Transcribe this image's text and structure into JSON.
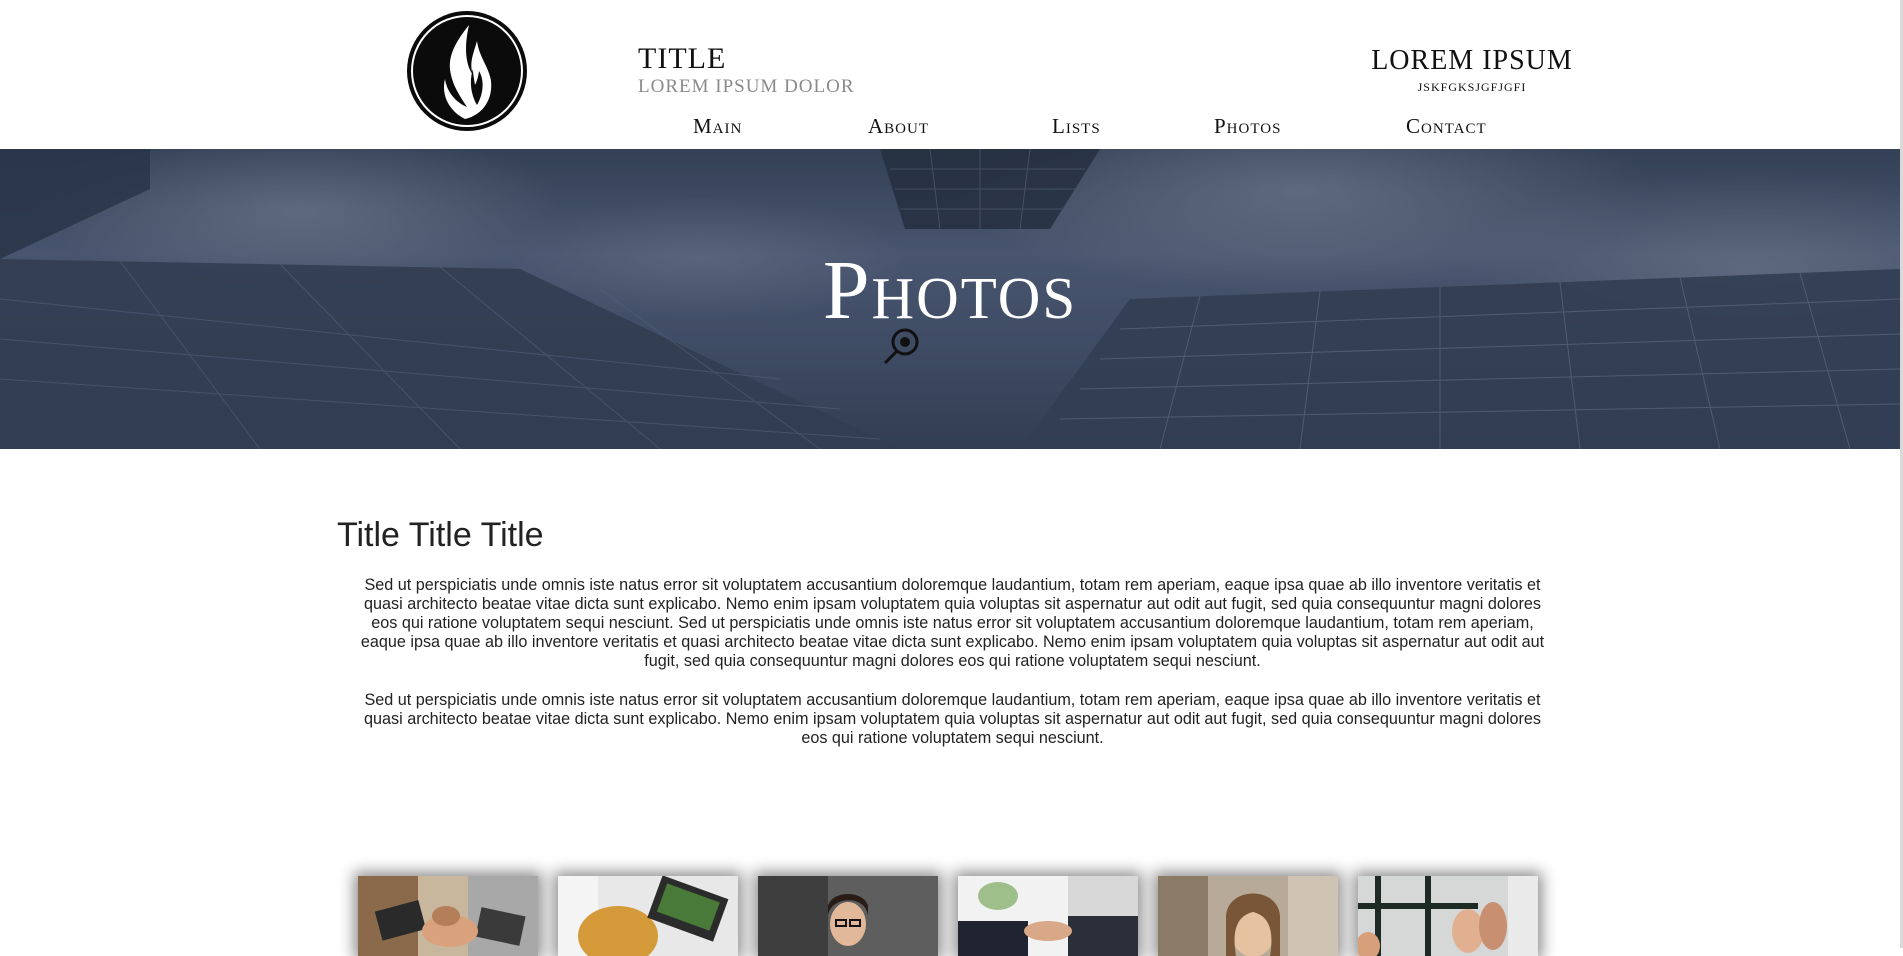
{
  "header": {
    "title": "TITLE",
    "subtitle": "LOREM IPSUM DOLOR",
    "right_title": "LOREM IPSUM",
    "right_subtitle": "JSKFGKSJGFJGFI"
  },
  "nav": {
    "items": [
      {
        "label": "Main"
      },
      {
        "label": "About"
      },
      {
        "label": "Lists"
      },
      {
        "label": "Photos"
      },
      {
        "label": "Contact"
      }
    ]
  },
  "hero": {
    "title": "Photos"
  },
  "content": {
    "title": "Title Title Title",
    "paragraphs": [
      "Sed ut perspiciatis unde omnis iste natus error sit voluptatem accusantium doloremque laudantium, totam rem aperiam, eaque ipsa quae ab illo inventore veritatis et quasi architecto beatae vitae dicta sunt explicabo. Nemo enim ipsam voluptatem quia voluptas sit aspernatur aut odit aut fugit, sed quia consequuntur magni dolores eos qui ratione voluptatem sequi nesciunt. Sed ut perspiciatis unde omnis iste natus error sit voluptatem accusantium doloremque laudantium, totam rem aperiam, eaque ipsa quae ab illo inventore veritatis et quasi architecto beatae vitae dicta sunt explicabo. Nemo enim ipsam voluptatem quia voluptas sit aspernatur aut odit aut fugit, sed quia consequuntur magni dolores eos qui ratione voluptatem sequi nesciunt.",
      "Sed ut perspiciatis unde omnis iste natus error sit voluptatem accusantium doloremque laudantium, totam rem aperiam, eaque ipsa quae ab illo inventore veritatis et quasi architecto beatae vitae dicta sunt explicabo. Nemo enim ipsam voluptatem quia voluptas sit aspernatur aut odit aut fugit, sed quia consequuntur magni dolores eos qui ratione voluptatem sequi nesciunt."
    ]
  },
  "gallery": {
    "photos": [
      {
        "icon": "team-hands-photo"
      },
      {
        "icon": "laptop-work-photo"
      },
      {
        "icon": "woman-glasses-photo"
      },
      {
        "icon": "handshake-photo"
      },
      {
        "icon": "smiling-woman-photo"
      },
      {
        "icon": "high-five-photo"
      }
    ]
  },
  "colors": {
    "accent": "#111111",
    "subtitle": "#8a8a8a",
    "hero_overlay": "#4a5870"
  }
}
